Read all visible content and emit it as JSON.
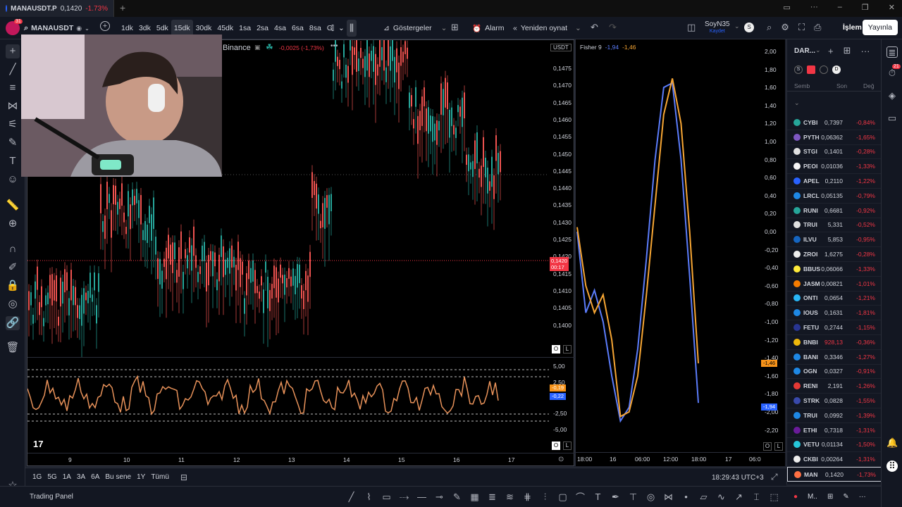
{
  "browser_tab": {
    "symbol": "MANAUSDT.P",
    "price": "0,1420",
    "change": "-1.73%",
    "badge": "31"
  },
  "toolbar": {
    "symbol": "MANAUSDT",
    "intervals": [
      "1dk",
      "3dk",
      "5dk",
      "15dk",
      "30dk",
      "45dk",
      "1sa",
      "2sa",
      "4sa",
      "6sa",
      "8sa",
      "G"
    ],
    "active_interval": "15dk",
    "indicators_label": "Göstergeler",
    "alarm_label": "Alarm",
    "replay_label": "Yeniden oynat",
    "layout_name": "SoyN35",
    "layout_sub": "Kaydet",
    "trade_label": "İşlem",
    "publish_label": "Yayınla",
    "avatar_letter": "S"
  },
  "main_chart": {
    "exchange": "Binance",
    "change": "-0,0025 (-1,73%)",
    "currency": "USDT",
    "price_ticks": [
      "0,1475",
      "0,1470",
      "0,1465",
      "0,1460",
      "0,1455",
      "0,1450",
      "0,1445",
      "0,1440",
      "0,1435",
      "0,1430",
      "0,1425",
      "0,1420",
      "0,1415",
      "0,1410",
      "0,1405",
      "0,1400"
    ],
    "last_price": "0,1420",
    "countdown": "00:17",
    "osc_ticks": [
      "5,00",
      "2,50",
      "-2,50",
      "-5,00"
    ],
    "osc_val1": "-0,19",
    "osc_val2": "-0,22",
    "time_ticks": [
      "9",
      "10",
      "11",
      "12",
      "13",
      "14",
      "15",
      "16",
      "17"
    ],
    "log_btn": "L",
    "o_btn": "O"
  },
  "fisher": {
    "name": "Fisher 9",
    "v1": "-1,94",
    "v2": "-1,46",
    "ticks": [
      "2,00",
      "1,80",
      "1,60",
      "1,40",
      "1,20",
      "1,00",
      "0,80",
      "0,60",
      "0,40",
      "0,20",
      "0,00",
      "-0,20",
      "-0,40",
      "-0,60",
      "-0,80",
      "-1,00",
      "-1,20",
      "-1,40",
      "-1,60",
      "-1,80",
      "-2,00",
      "-2,20"
    ],
    "time_ticks": [
      "18:00",
      "16",
      "06:00",
      "12:00",
      "18:00",
      "17",
      "06:0"
    ],
    "series": {
      "blue": [
        0.0,
        -0.9,
        -0.65,
        -1.0,
        -1.6,
        -2.1,
        -1.95,
        -1.3,
        -0.3,
        0.8,
        1.6,
        1.65,
        0.8,
        -0.5,
        -1.9
      ],
      "orange": [
        0.05,
        -0.6,
        -0.9,
        -0.7,
        -1.2,
        -2.05,
        -2.0,
        -1.6,
        -0.7,
        0.3,
        1.3,
        1.7,
        1.2,
        0.0,
        -1.46
      ]
    }
  },
  "watchlist": {
    "title": "DAR...",
    "columns": [
      "Semb",
      "Son",
      "Değ"
    ],
    "rows": [
      {
        "sym": "CYBI",
        "last": "0,7397",
        "chg": "-0,84%",
        "color": "#26a69a"
      },
      {
        "sym": "PYTH",
        "last": "0,06362",
        "chg": "-1,65%",
        "color": "#7e57c2"
      },
      {
        "sym": "STGI",
        "last": "0,1401",
        "chg": "-0,28%",
        "color": "#e0e0e0"
      },
      {
        "sym": "PEOI",
        "last": "0,01036",
        "chg": "-1,33%",
        "color": "#f5f5f5"
      },
      {
        "sym": "APEL",
        "last": "0,2110",
        "chg": "-1,22%",
        "color": "#2962ff"
      },
      {
        "sym": "LRCL",
        "last": "0,05135",
        "chg": "-0,79%",
        "color": "#1e88e5"
      },
      {
        "sym": "RUNI",
        "last": "0,6681",
        "chg": "-0,92%",
        "color": "#26a69a"
      },
      {
        "sym": "TRUI",
        "last": "5,331",
        "chg": "-0,52%",
        "color": "#e0e0e0"
      },
      {
        "sym": "ILVU",
        "last": "5,853",
        "chg": "-0,95%",
        "color": "#1565c0"
      },
      {
        "sym": "ZROI",
        "last": "1,6275",
        "chg": "-0,28%",
        "color": "#eeeeee"
      },
      {
        "sym": "BBUS",
        "last": "0,06066",
        "chg": "-1,33%",
        "color": "#ffeb3b"
      },
      {
        "sym": "JASM",
        "last": "0,00821",
        "chg": "-1,01%",
        "color": "#f57c00"
      },
      {
        "sym": "ONTI",
        "last": "0,0654",
        "chg": "-1,21%",
        "color": "#29b6f6"
      },
      {
        "sym": "IOUS",
        "last": "0,1631",
        "chg": "-1,81%",
        "color": "#1e88e5"
      },
      {
        "sym": "FETU",
        "last": "0,2744",
        "chg": "-1,15%",
        "color": "#283593"
      },
      {
        "sym": "BNBI",
        "last": "928,13",
        "chg": "-0,36%",
        "color": "#f0b90b",
        "last_red": true
      },
      {
        "sym": "BANI",
        "last": "0,3346",
        "chg": "-1,27%",
        "color": "#1e88e5"
      },
      {
        "sym": "OGN",
        "last": "0,0327",
        "chg": "-0,91%",
        "color": "#1e88e5"
      },
      {
        "sym": "RENI",
        "last": "2,191",
        "chg": "-1,26%",
        "color": "#e53935"
      },
      {
        "sym": "STRK",
        "last": "0,0828",
        "chg": "-1,55%",
        "color": "#3949ab"
      },
      {
        "sym": "TRUI",
        "last": "0,0992",
        "chg": "-1,39%",
        "color": "#1e88e5"
      },
      {
        "sym": "ETHI",
        "last": "0,7318",
        "chg": "-1,31%",
        "color": "#6a1b9a"
      },
      {
        "sym": "VETU",
        "last": "0,01134",
        "chg": "-1,50%",
        "color": "#26c6da"
      },
      {
        "sym": "CKBI",
        "last": "0,00264",
        "chg": "-1,31%",
        "color": "#eeeeee"
      },
      {
        "sym": "MAN",
        "last": "0,1420",
        "chg": "-1,73%",
        "color": "#ff7043"
      }
    ],
    "right_badge": "21",
    "footer_label": "M.."
  },
  "bottom": {
    "ranges": [
      "1G",
      "5G",
      "1A",
      "3A",
      "6A",
      "Bu sene",
      "1Y",
      "Tümü"
    ],
    "clock": "18:29:43 UTC+3",
    "panel_label": "Trading Panel"
  }
}
